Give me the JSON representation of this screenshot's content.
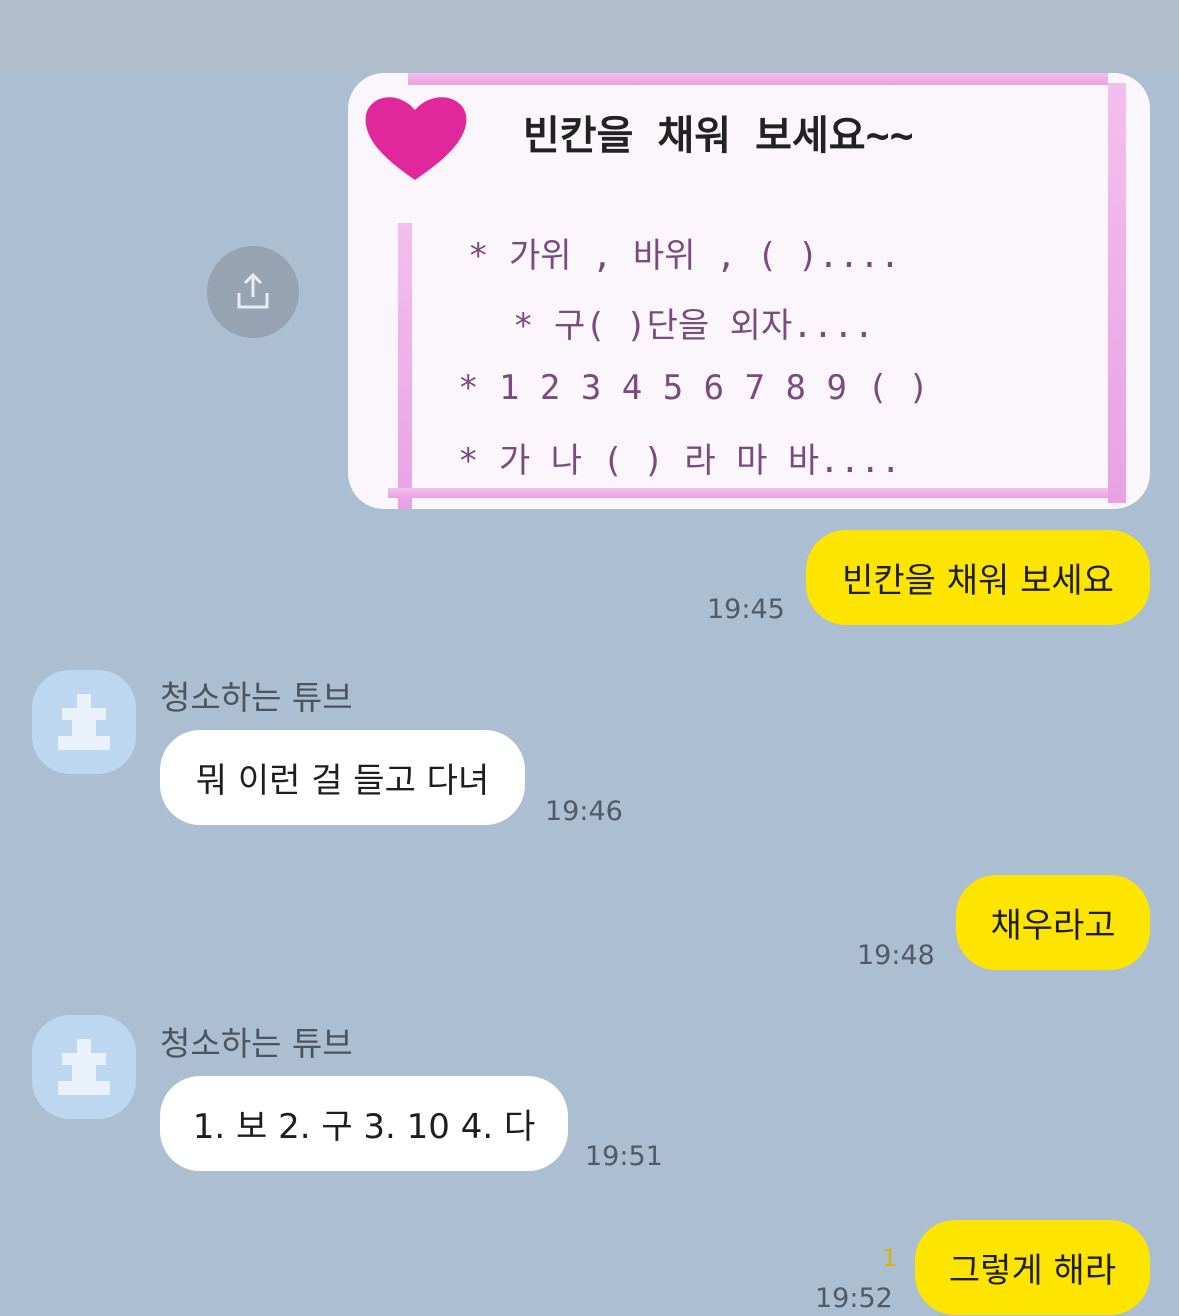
{
  "image_message": {
    "title": "빈칸을 채워 보세요~~",
    "lines": [
      "* 가위 , 바위 , (   )....",
      "* 구(   )단을 외자....",
      "* 1 2 3 4 5 6 7 8 9 (   )",
      "* 가 나 (   ) 라 마 바...."
    ]
  },
  "messages": [
    {
      "side": "me",
      "text": "빈칸을 채워 보세요",
      "time": "19:45"
    },
    {
      "side": "other",
      "sender": "청소하는 튜브",
      "text": "뭐 이런 걸 들고 다녀",
      "time": "19:46"
    },
    {
      "side": "me",
      "text": "채우라고",
      "time": "19:48"
    },
    {
      "side": "other",
      "sender": "청소하는 튜브",
      "text": "1. 보 2. 구 3. 10 4. 다",
      "time": "19:51"
    },
    {
      "side": "me",
      "text": "그렇게 해라",
      "time": "19:52",
      "unread": "1"
    }
  ],
  "colors": {
    "background": "#abbed2",
    "my_bubble": "#fee500",
    "other_bubble": "#ffffff"
  },
  "icons": {
    "share": "share-icon",
    "avatar": "default-avatar-icon"
  }
}
